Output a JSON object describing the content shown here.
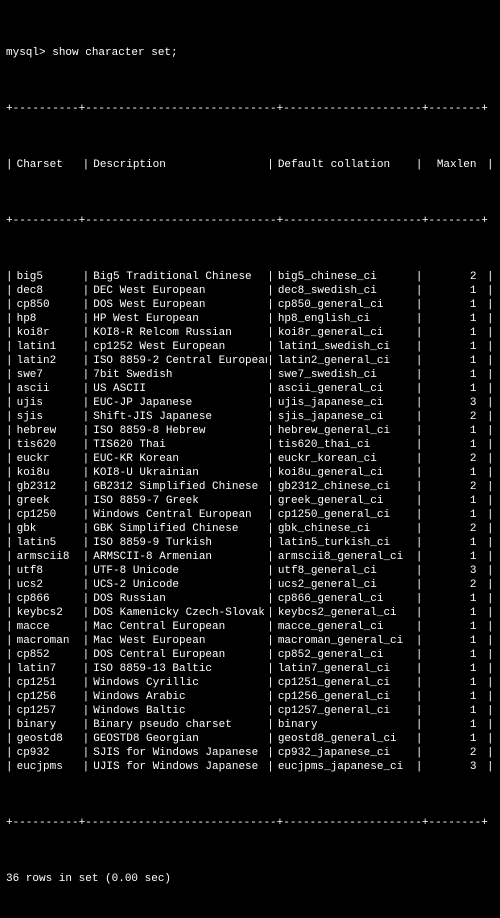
{
  "prompt": "mysql> ",
  "command": "show character set;",
  "headers": {
    "charset": "Charset",
    "description": "Description",
    "collation": "Default collation",
    "maxlen": "Maxlen"
  },
  "rows": [
    {
      "charset": "big5",
      "description": "Big5 Traditional Chinese",
      "collation": "big5_chinese_ci",
      "maxlen": "2"
    },
    {
      "charset": "dec8",
      "description": "DEC West European",
      "collation": "dec8_swedish_ci",
      "maxlen": "1"
    },
    {
      "charset": "cp850",
      "description": "DOS West European",
      "collation": "cp850_general_ci",
      "maxlen": "1"
    },
    {
      "charset": "hp8",
      "description": "HP West European",
      "collation": "hp8_english_ci",
      "maxlen": "1"
    },
    {
      "charset": "koi8r",
      "description": "KOI8-R Relcom Russian",
      "collation": "koi8r_general_ci",
      "maxlen": "1"
    },
    {
      "charset": "latin1",
      "description": "cp1252 West European",
      "collation": "latin1_swedish_ci",
      "maxlen": "1"
    },
    {
      "charset": "latin2",
      "description": "ISO 8859-2 Central European",
      "collation": "latin2_general_ci",
      "maxlen": "1"
    },
    {
      "charset": "swe7",
      "description": "7bit Swedish",
      "collation": "swe7_swedish_ci",
      "maxlen": "1"
    },
    {
      "charset": "ascii",
      "description": "US ASCII",
      "collation": "ascii_general_ci",
      "maxlen": "1"
    },
    {
      "charset": "ujis",
      "description": "EUC-JP Japanese",
      "collation": "ujis_japanese_ci",
      "maxlen": "3"
    },
    {
      "charset": "sjis",
      "description": "Shift-JIS Japanese",
      "collation": "sjis_japanese_ci",
      "maxlen": "2"
    },
    {
      "charset": "hebrew",
      "description": "ISO 8859-8 Hebrew",
      "collation": "hebrew_general_ci",
      "maxlen": "1"
    },
    {
      "charset": "tis620",
      "description": "TIS620 Thai",
      "collation": "tis620_thai_ci",
      "maxlen": "1"
    },
    {
      "charset": "euckr",
      "description": "EUC-KR Korean",
      "collation": "euckr_korean_ci",
      "maxlen": "2"
    },
    {
      "charset": "koi8u",
      "description": "KOI8-U Ukrainian",
      "collation": "koi8u_general_ci",
      "maxlen": "1"
    },
    {
      "charset": "gb2312",
      "description": "GB2312 Simplified Chinese",
      "collation": "gb2312_chinese_ci",
      "maxlen": "2"
    },
    {
      "charset": "greek",
      "description": "ISO 8859-7 Greek",
      "collation": "greek_general_ci",
      "maxlen": "1"
    },
    {
      "charset": "cp1250",
      "description": "Windows Central European",
      "collation": "cp1250_general_ci",
      "maxlen": "1"
    },
    {
      "charset": "gbk",
      "description": "GBK Simplified Chinese",
      "collation": "gbk_chinese_ci",
      "maxlen": "2"
    },
    {
      "charset": "latin5",
      "description": "ISO 8859-9 Turkish",
      "collation": "latin5_turkish_ci",
      "maxlen": "1"
    },
    {
      "charset": "armscii8",
      "description": "ARMSCII-8 Armenian",
      "collation": "armscii8_general_ci",
      "maxlen": "1"
    },
    {
      "charset": "utf8",
      "description": "UTF-8 Unicode",
      "collation": "utf8_general_ci",
      "maxlen": "3"
    },
    {
      "charset": "ucs2",
      "description": "UCS-2 Unicode",
      "collation": "ucs2_general_ci",
      "maxlen": "2"
    },
    {
      "charset": "cp866",
      "description": "DOS Russian",
      "collation": "cp866_general_ci",
      "maxlen": "1"
    },
    {
      "charset": "keybcs2",
      "description": "DOS Kamenicky Czech-Slovak",
      "collation": "keybcs2_general_ci",
      "maxlen": "1"
    },
    {
      "charset": "macce",
      "description": "Mac Central European",
      "collation": "macce_general_ci",
      "maxlen": "1"
    },
    {
      "charset": "macroman",
      "description": "Mac West European",
      "collation": "macroman_general_ci",
      "maxlen": "1"
    },
    {
      "charset": "cp852",
      "description": "DOS Central European",
      "collation": "cp852_general_ci",
      "maxlen": "1"
    },
    {
      "charset": "latin7",
      "description": "ISO 8859-13 Baltic",
      "collation": "latin7_general_ci",
      "maxlen": "1"
    },
    {
      "charset": "cp1251",
      "description": "Windows Cyrillic",
      "collation": "cp1251_general_ci",
      "maxlen": "1"
    },
    {
      "charset": "cp1256",
      "description": "Windows Arabic",
      "collation": "cp1256_general_ci",
      "maxlen": "1"
    },
    {
      "charset": "cp1257",
      "description": "Windows Baltic",
      "collation": "cp1257_general_ci",
      "maxlen": "1"
    },
    {
      "charset": "binary",
      "description": "Binary pseudo charset",
      "collation": "binary",
      "maxlen": "1"
    },
    {
      "charset": "geostd8",
      "description": "GEOSTD8 Georgian",
      "collation": "geostd8_general_ci",
      "maxlen": "1"
    },
    {
      "charset": "cp932",
      "description": "SJIS for Windows Japanese",
      "collation": "cp932_japanese_ci",
      "maxlen": "2"
    },
    {
      "charset": "eucjpms",
      "description": "UJIS for Windows Japanese",
      "collation": "eucjpms_japanese_ci",
      "maxlen": "3"
    }
  ],
  "footer": "36 rows in set (0.00 sec)",
  "border": "+----------+-----------------------------+---------------------+--------+"
}
